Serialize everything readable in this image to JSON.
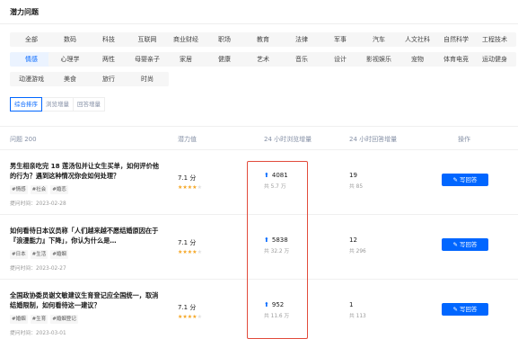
{
  "page": {
    "title": "潜力问题"
  },
  "categories": {
    "row1": [
      "全部",
      "数码",
      "科技",
      "互联网",
      "商业财经",
      "职场",
      "教育",
      "法律",
      "军事",
      "汽车",
      "人文社科",
      "自然科学",
      "工程技术"
    ],
    "row2": [
      "情感",
      "心理学",
      "两性",
      "母婴亲子",
      "家居",
      "健康",
      "艺术",
      "音乐",
      "设计",
      "影视娱乐",
      "宠物",
      "体育电竞",
      "运动健身"
    ],
    "row3": [
      "动漫游戏",
      "美食",
      "旅行",
      "时尚"
    ],
    "active": "情感"
  },
  "sort_tabs": [
    "综合排序",
    "浏览增量",
    "回答增量"
  ],
  "sort_active": "综合排序",
  "table": {
    "headers": {
      "question": "问题 200",
      "potential": "潜力值",
      "views": "24 小时浏览增量",
      "answers": "24 小时回答增量",
      "action": "操作"
    },
    "rows": [
      {
        "title": "男生相亲吃完 18 莲汤包并让女生买单，如何评价他的行为？遇到这种情况你会如何处理？",
        "tags": [
          "#情感",
          "#社会",
          "#婚恋"
        ],
        "time": "提问时间：2023-02-28",
        "potential": "7.1 分",
        "stars": 4,
        "views_main": "4081",
        "views_sub": "共 5.7 万",
        "answers_main": "19",
        "answers_sub": "共 85",
        "button": "写回答"
      },
      {
        "title": "如何看待日本议员称「人们越来越不愿结婚原因在于『浪漫能力』下降」，你认为什么是…",
        "tags": [
          "#日本",
          "#生活",
          "#婚姻"
        ],
        "time": "提问时间：2023-02-27",
        "potential": "7.1 分",
        "stars": 4,
        "views_main": "5838",
        "views_sub": "共 32.2 万",
        "answers_main": "12",
        "answers_sub": "共 296",
        "button": "写回答"
      },
      {
        "title": "全国政协委员谢文敏建议生育登记应全国统一，取消结婚限制，如何看待这一建议？",
        "tags": [
          "#婚姻",
          "#生育",
          "#婚姻登记"
        ],
        "time": "提问时间：2023-03-01",
        "potential": "7.1 分",
        "stars": 4,
        "views_main": "952",
        "views_sub": "共 11.6 万",
        "answers_main": "1",
        "answers_sub": "共 113",
        "button": "写回答"
      }
    ]
  },
  "colors": {
    "accent": "#0066ff",
    "highlight": "#e24b3b",
    "star": "#f5a623"
  },
  "icons": {
    "views_trend": "arrow-up-icon",
    "write": "pencil-icon",
    "rating": "star-icon"
  }
}
